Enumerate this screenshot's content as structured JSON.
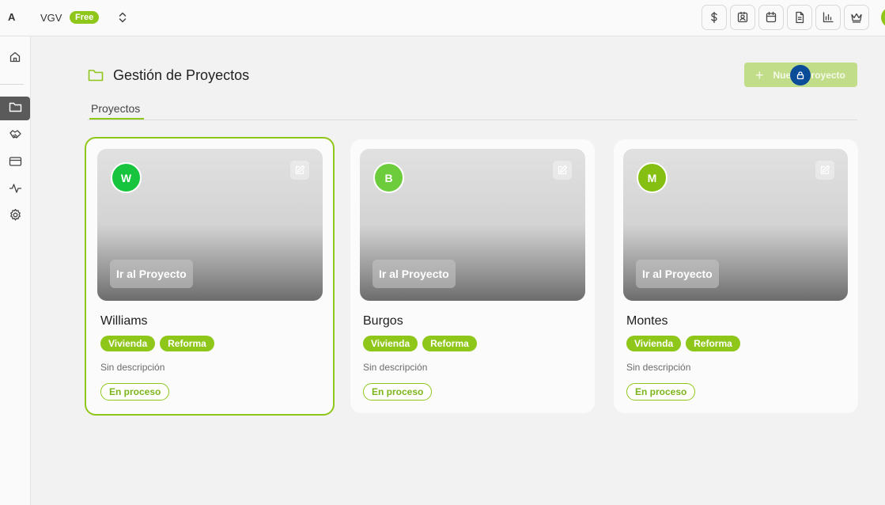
{
  "topbar": {
    "brand_letter": "A",
    "org_name": "VGV",
    "plan_badge": "Free",
    "tools": [
      {
        "icon": "dollar-icon"
      },
      {
        "icon": "contact-card-icon"
      },
      {
        "icon": "calendar-icon"
      },
      {
        "icon": "document-icon"
      },
      {
        "icon": "bar-chart-icon"
      },
      {
        "icon": "crown-icon"
      }
    ]
  },
  "sidebar": {
    "items": [
      {
        "icon": "home-icon",
        "active": false
      },
      {
        "icon": "folder-icon",
        "active": true
      },
      {
        "icon": "handshake-icon",
        "active": false
      },
      {
        "icon": "credit-card-icon",
        "active": false
      },
      {
        "icon": "activity-icon",
        "active": false
      },
      {
        "icon": "settings-icon",
        "active": false
      }
    ]
  },
  "header": {
    "title": "Gestión de Proyectos",
    "new_button_label": "Nuevo Proyecto"
  },
  "tabs": [
    {
      "label": "Proyectos",
      "active": true
    }
  ],
  "projects": [
    {
      "initial": "W",
      "initial_color": "#16c43e",
      "go_label": "Ir al Proyecto",
      "name": "Williams",
      "tags": [
        "Vivienda",
        "Reforma"
      ],
      "description": "Sin descripción",
      "status": "En proceso",
      "selected": true
    },
    {
      "initial": "B",
      "initial_color": "#6ccc3c",
      "go_label": "Ir al Proyecto",
      "name": "Burgos",
      "tags": [
        "Vivienda",
        "Reforma"
      ],
      "description": "Sin descripción",
      "status": "En proceso",
      "selected": false
    },
    {
      "initial": "M",
      "initial_color": "#84bf12",
      "go_label": "Ir al Proyecto",
      "name": "Montes",
      "tags": [
        "Vivienda",
        "Reforma"
      ],
      "description": "Sin descripción",
      "status": "En proceso",
      "selected": false
    }
  ],
  "colors": {
    "accent": "#8fc61a",
    "lock_badge": "#0b4c98"
  }
}
